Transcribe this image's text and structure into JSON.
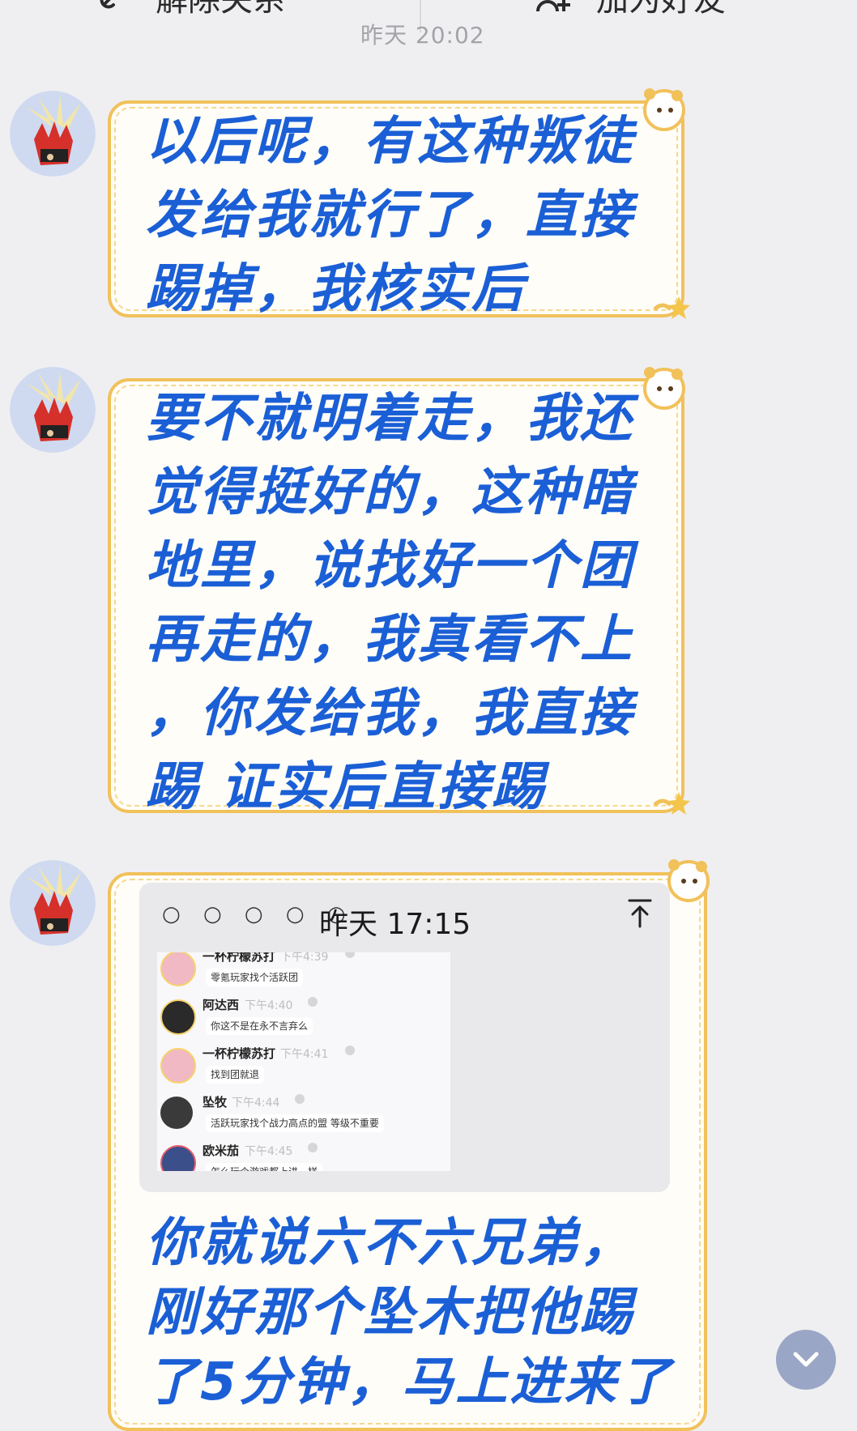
{
  "top_bar": {
    "unfriend_label": "解除关系",
    "add_friend_label": "加为好友",
    "timestamp": "昨天 20:02"
  },
  "messages": [
    {
      "lines": [
        "以后呢，有这种叛徒",
        "发给我就行了，直接",
        "踢掉，我核实后"
      ]
    },
    {
      "lines": [
        "要不就明着走，我还",
        "觉得挺好的，这种暗",
        "地里，说找好一个团",
        "再走的，我真看不上",
        "，你发给我，我直接",
        "踢 证实后直接踢"
      ]
    },
    {
      "screenshot": {
        "status_dots": "○ ○ ○ ○ ○",
        "time": "昨天 17:15",
        "share_icon": "share-up-icon",
        "entries": [
          {
            "name": "一杯柠檬苏打",
            "time": "下午4:39",
            "text": "零氪玩家找个活跃团"
          },
          {
            "name": "阿达西",
            "time": "下午4:40",
            "text": "你这不是在永不言弃么"
          },
          {
            "name": "一杯柠檬苏打",
            "time": "下午4:41",
            "text": "找到团就退"
          },
          {
            "name": "坠牧",
            "time": "下午4:44",
            "text": "活跃玩家找个战力高点的盟 等级不重要"
          },
          {
            "name": "欧米茄",
            "time": "下午4:45",
            "text": "怎么玩个游戏都上进一样"
          }
        ]
      },
      "lines": [
        "你就说六不六兄弟，",
        "刚好那个坠木把他踢",
        "了5分钟，马上进来了"
      ]
    }
  ],
  "colors": {
    "bubble_text": "#1b5fd6",
    "bubble_border": "#f1c15a",
    "background": "#efeff2"
  },
  "scroll_button_icon": "chevron-down-icon"
}
